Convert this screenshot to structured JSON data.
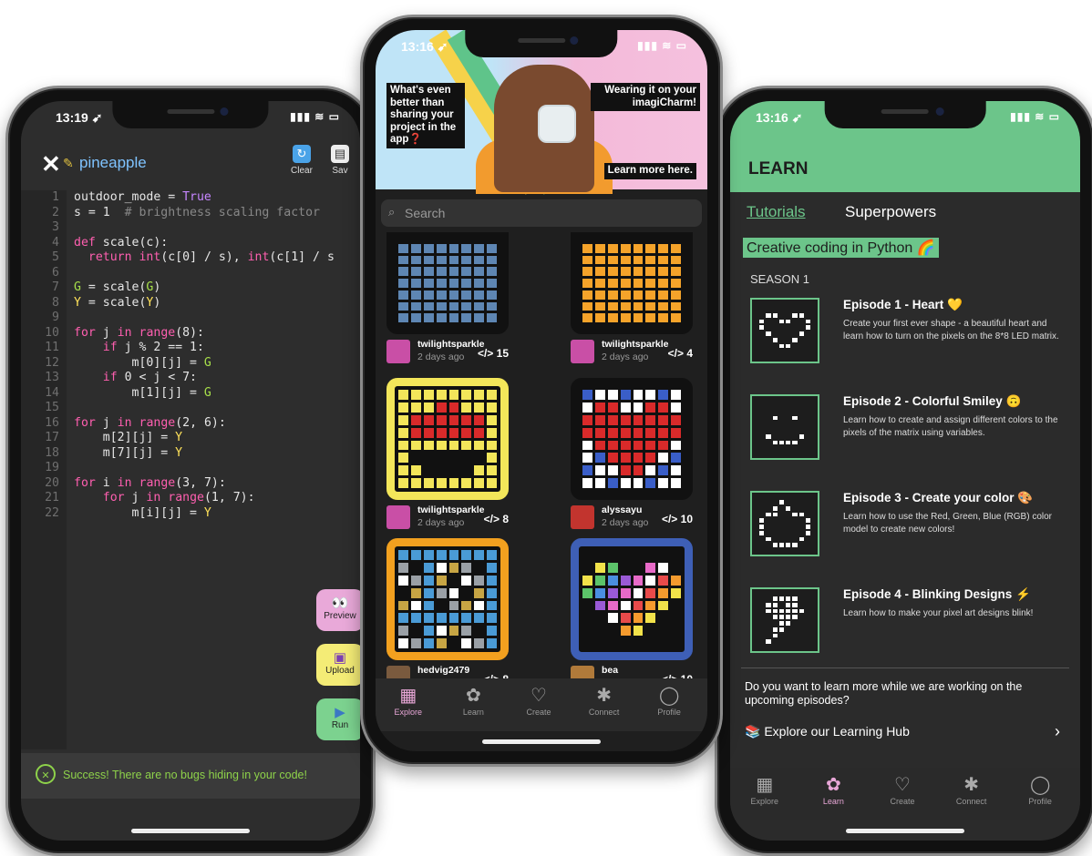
{
  "left_phone": {
    "status": {
      "time": "13:19 ➹",
      "right": "▮▮▮ ≋ ▭"
    },
    "header": {
      "close": "✕",
      "project_name": "pineapple",
      "clear_label": "Clear",
      "save_label": "Sav"
    },
    "line_numbers": [
      "1",
      "2",
      "3",
      "4",
      "5",
      "6",
      "7",
      "8",
      "9",
      "10",
      "11",
      "12",
      "13",
      "14",
      "15",
      "16",
      "17",
      "18",
      "19",
      "20",
      "21",
      "22"
    ],
    "code_lines": [
      "outdoor_mode = True",
      "s = 1  # brightness scaling factor",
      "",
      "def scale(c):",
      "  return int(c[0] / s), int(c[1] / s",
      "",
      "G = scale(G)",
      "Y = scale(Y)",
      "",
      "for j in range(8):",
      "    if j % 2 == 1:",
      "        m[0][j] = G",
      "    if 0 < j < 7:",
      "        m[1][j] = G",
      "",
      "for j in range(2, 6):",
      "    m[2][j] = Y",
      "    m[7][j] = Y",
      "",
      "for i in range(3, 7):",
      "    for j in range(1, 7):",
      "        m[i][j] = Y"
    ],
    "side_buttons": {
      "preview": "Preview",
      "upload": "Upload",
      "run": "Run"
    },
    "success_message": "Success! There are no bugs hiding in your code!"
  },
  "center_phone": {
    "status": {
      "time": "13:16 ➹",
      "right": "▮▮▮ ≋ ▭"
    },
    "hero": {
      "left_text": "What's even better than sharing your project in the app❓",
      "right_text": "Wearing it on your imagiCharm!",
      "cta": "Learn more here."
    },
    "search_placeholder": "Search",
    "cards": [
      {
        "user": "twilightsparkle",
        "ago": "2 days ago",
        "count": "</> 15"
      },
      {
        "user": "twilightsparkle",
        "ago": "2 days ago",
        "count": "</> 4"
      },
      {
        "user": "twilightsparkle",
        "ago": "2 days ago",
        "count": "</> 8"
      },
      {
        "user": "alyssayu",
        "ago": "2 days ago",
        "count": "</> 10"
      },
      {
        "user": "hedvig2479",
        "ago": "2 days ago",
        "count": "</> 8"
      },
      {
        "user": "bea",
        "ago": "2 days ago",
        "count": "</> 10"
      }
    ],
    "tabs": [
      "Explore",
      "Learn",
      "Create",
      "Connect",
      "Profile"
    ],
    "active_tab": "Explore"
  },
  "right_phone": {
    "status": {
      "time": "13:16 ➹",
      "right": "▮▮▮ ≋ ▭"
    },
    "title": "LEARN",
    "tabs": [
      "Tutorials",
      "Superpowers"
    ],
    "course_title": "Creative coding in Python 🌈",
    "season": "SEASON 1",
    "episodes": [
      {
        "title": "Episode 1 - Heart 💛",
        "desc": "Create your first ever shape - a beautiful heart and learn how to turn on the pixels on the 8*8 LED matrix."
      },
      {
        "title": "Episode 2 - Colorful Smiley 🙃",
        "desc": "Learn how to create and assign different colors to the pixels of the matrix using variables."
      },
      {
        "title": "Episode 3 - Create your color 🎨",
        "desc": "Learn how to use the Red, Green, Blue (RGB) color model to create new colors!"
      },
      {
        "title": "Episode 4 - Blinking Designs ⚡",
        "desc": "Learn how to make your pixel art designs blink!"
      }
    ],
    "learn_more_text": "Do you want to learn more while we are working on the upcoming episodes?",
    "hub_link": "Explore our Learning Hub",
    "tabbar": [
      "Explore",
      "Learn",
      "Create",
      "Connect",
      "Profile"
    ],
    "active_tab": "Learn"
  },
  "colors": {
    "accent_green": "#6cc58a",
    "pink": "#e7a6d6",
    "code_pink": "#ff5fb0",
    "success_green": "#8ed24a"
  }
}
